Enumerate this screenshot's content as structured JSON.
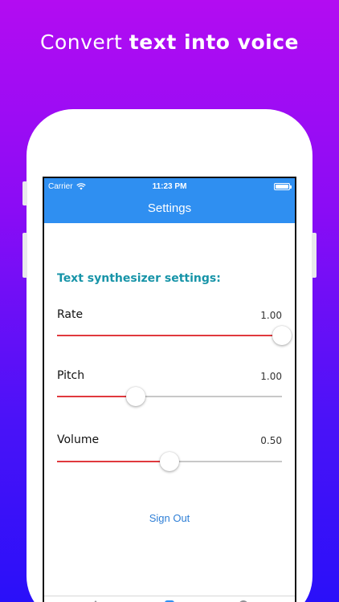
{
  "promo": {
    "headline_light": "Convert",
    "headline_bold": "text into voice"
  },
  "colors": {
    "background_top": "#b30cf2",
    "background_bottom": "#2a10f9",
    "navbar": "#2f8ff1",
    "section_title": "#1794a8",
    "slider_fill": "#e0393e",
    "slider_track": "#c8c8c8",
    "link": "#2f7fd6"
  },
  "status_bar": {
    "carrier": "Carrier",
    "time": "11:23 PM"
  },
  "navbar": {
    "title": "Settings"
  },
  "settings": {
    "section_title": "Text synthesizer settings:",
    "rows": [
      {
        "label": "Rate",
        "value": "1.00",
        "fraction": 1.0
      },
      {
        "label": "Pitch",
        "value": "1.00",
        "fraction": 0.35
      },
      {
        "label": "Volume",
        "value": "0.50",
        "fraction": 0.5
      }
    ]
  },
  "actions": {
    "sign_out": "Sign Out"
  },
  "tabbar": {
    "icons": [
      "home-icon",
      "settings-icon",
      "profile-icon"
    ],
    "selected": "settings-icon"
  }
}
